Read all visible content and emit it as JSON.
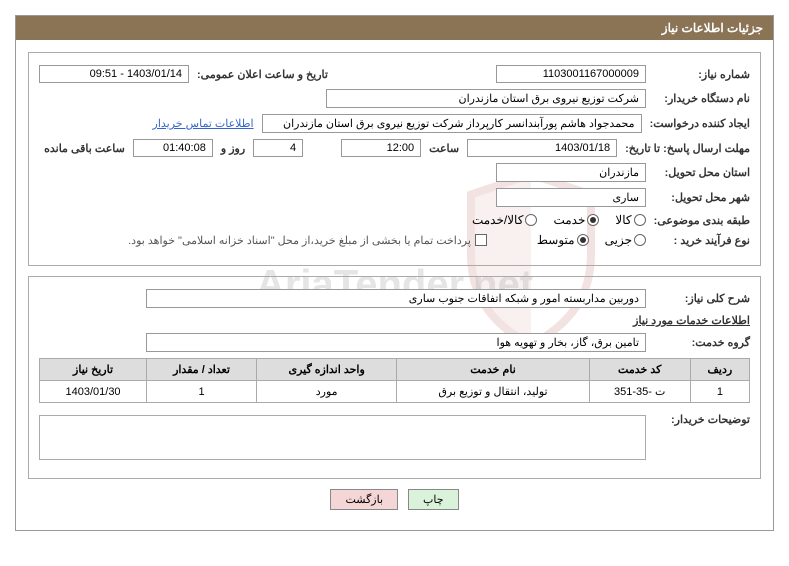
{
  "header": {
    "title": "جزئیات اطلاعات نیاز"
  },
  "fields": {
    "requirement_number": {
      "label": "شماره نیاز:",
      "value": "1103001167000009"
    },
    "announcement_date": {
      "label": "تاریخ و ساعت اعلان عمومی:",
      "value": "1403/01/14 - 09:51"
    },
    "buyer_org": {
      "label": "نام دستگاه خریدار:",
      "value": "شرکت توزیع نیروی برق استان مازندران"
    },
    "requester": {
      "label": "ایجاد کننده درخواست:",
      "value": "محمدجواد هاشم پورآبندانسر کارپرداز شرکت توزیع نیروی برق استان مازندران"
    },
    "buyer_contact_link": "اطلاعات تماس خریدار",
    "response_deadline": {
      "label": "مهلت ارسال پاسخ: تا تاریخ:",
      "date": "1403/01/18",
      "time_label": "ساعت",
      "time": "12:00",
      "days": "4",
      "days_label": "روز و",
      "duration": "01:40:08",
      "remaining_label": "ساعت باقی مانده"
    },
    "delivery_province": {
      "label": "استان محل تحویل:",
      "value": "مازندران"
    },
    "delivery_city": {
      "label": "شهر محل تحویل:",
      "value": "ساری"
    },
    "subject_class": {
      "label": "طبقه بندی موضوعی:",
      "options": {
        "goods": "کالا",
        "service": "خدمت",
        "goods_service": "کالا/خدمت"
      }
    },
    "purchase_type": {
      "label": "نوع فرآیند خرید :",
      "options": {
        "partial": "جزیی",
        "medium": "متوسط"
      }
    },
    "payment_note": "پرداخت تمام یا بخشی از مبلغ خرید،از محل \"اسناد خزانه اسلامی\" خواهد بود.",
    "general_desc": {
      "label": "شرح کلی نیاز:",
      "value": "دوربین مداربسته امور و شبکه اتفاقات جنوب ساری"
    },
    "service_info_title": "اطلاعات خدمات مورد نیاز",
    "service_group": {
      "label": "گروه خدمت:",
      "value": "تامین برق، گاز، بخار و تهویه هوا"
    },
    "buyer_notes": {
      "label": "توضیحات خریدار:"
    }
  },
  "table": {
    "headers": {
      "row": "ردیف",
      "code": "کد خدمت",
      "name": "نام خدمت",
      "unit": "واحد اندازه گیری",
      "qty": "تعداد / مقدار",
      "date": "تاریخ نیاز"
    },
    "rows": [
      {
        "row": "1",
        "code": "ت -35-351",
        "name": "تولید، انتقال و توزیع برق",
        "unit": "مورد",
        "qty": "1",
        "date": "1403/01/30"
      }
    ]
  },
  "buttons": {
    "print": "چاپ",
    "back": "بازگشت"
  },
  "watermark": "AriaTender.net"
}
